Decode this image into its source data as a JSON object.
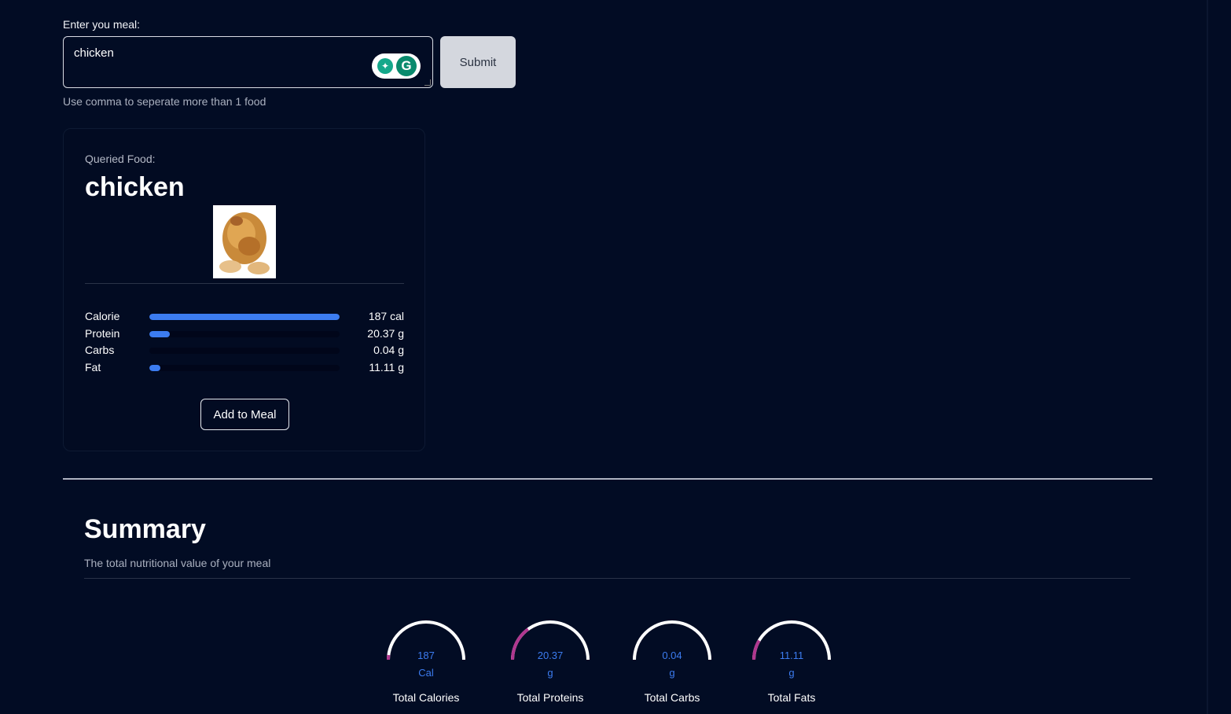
{
  "form": {
    "label": "Enter you meal:",
    "value": "chicken",
    "submit_label": "Submit",
    "hint": "Use comma to seperate more than 1 food"
  },
  "food_card": {
    "queried_label": "Queried Food:",
    "food_name": "chicken",
    "nutrients": [
      {
        "label": "Calorie",
        "value": "187 cal",
        "fraction": 1.0
      },
      {
        "label": "Protein",
        "value": "20.37 g",
        "fraction": 0.109
      },
      {
        "label": "Carbs",
        "value": "0.04 g",
        "fraction": 0.0002
      },
      {
        "label": "Fat",
        "value": "11.11 g",
        "fraction": 0.059
      }
    ],
    "add_button_label": "Add to Meal"
  },
  "summary": {
    "title": "Summary",
    "subtitle": "The total nutritional value of your meal",
    "gauges": [
      {
        "value": "187",
        "unit": "Cal",
        "label": "Total Calories",
        "fraction": 0.04
      },
      {
        "value": "20.37",
        "unit": "g",
        "label": "Total Proteins",
        "fraction": 0.3
      },
      {
        "value": "0.04",
        "unit": "g",
        "label": "Total Carbs",
        "fraction": 0.0
      },
      {
        "value": "11.11",
        "unit": "g",
        "label": "Total Fats",
        "fraction": 0.17
      }
    ]
  },
  "colors": {
    "background": "#020c24",
    "bar_fill": "#3c7cf0",
    "gauge_track": "#ffffff",
    "gauge_fill": "#b0378f"
  }
}
